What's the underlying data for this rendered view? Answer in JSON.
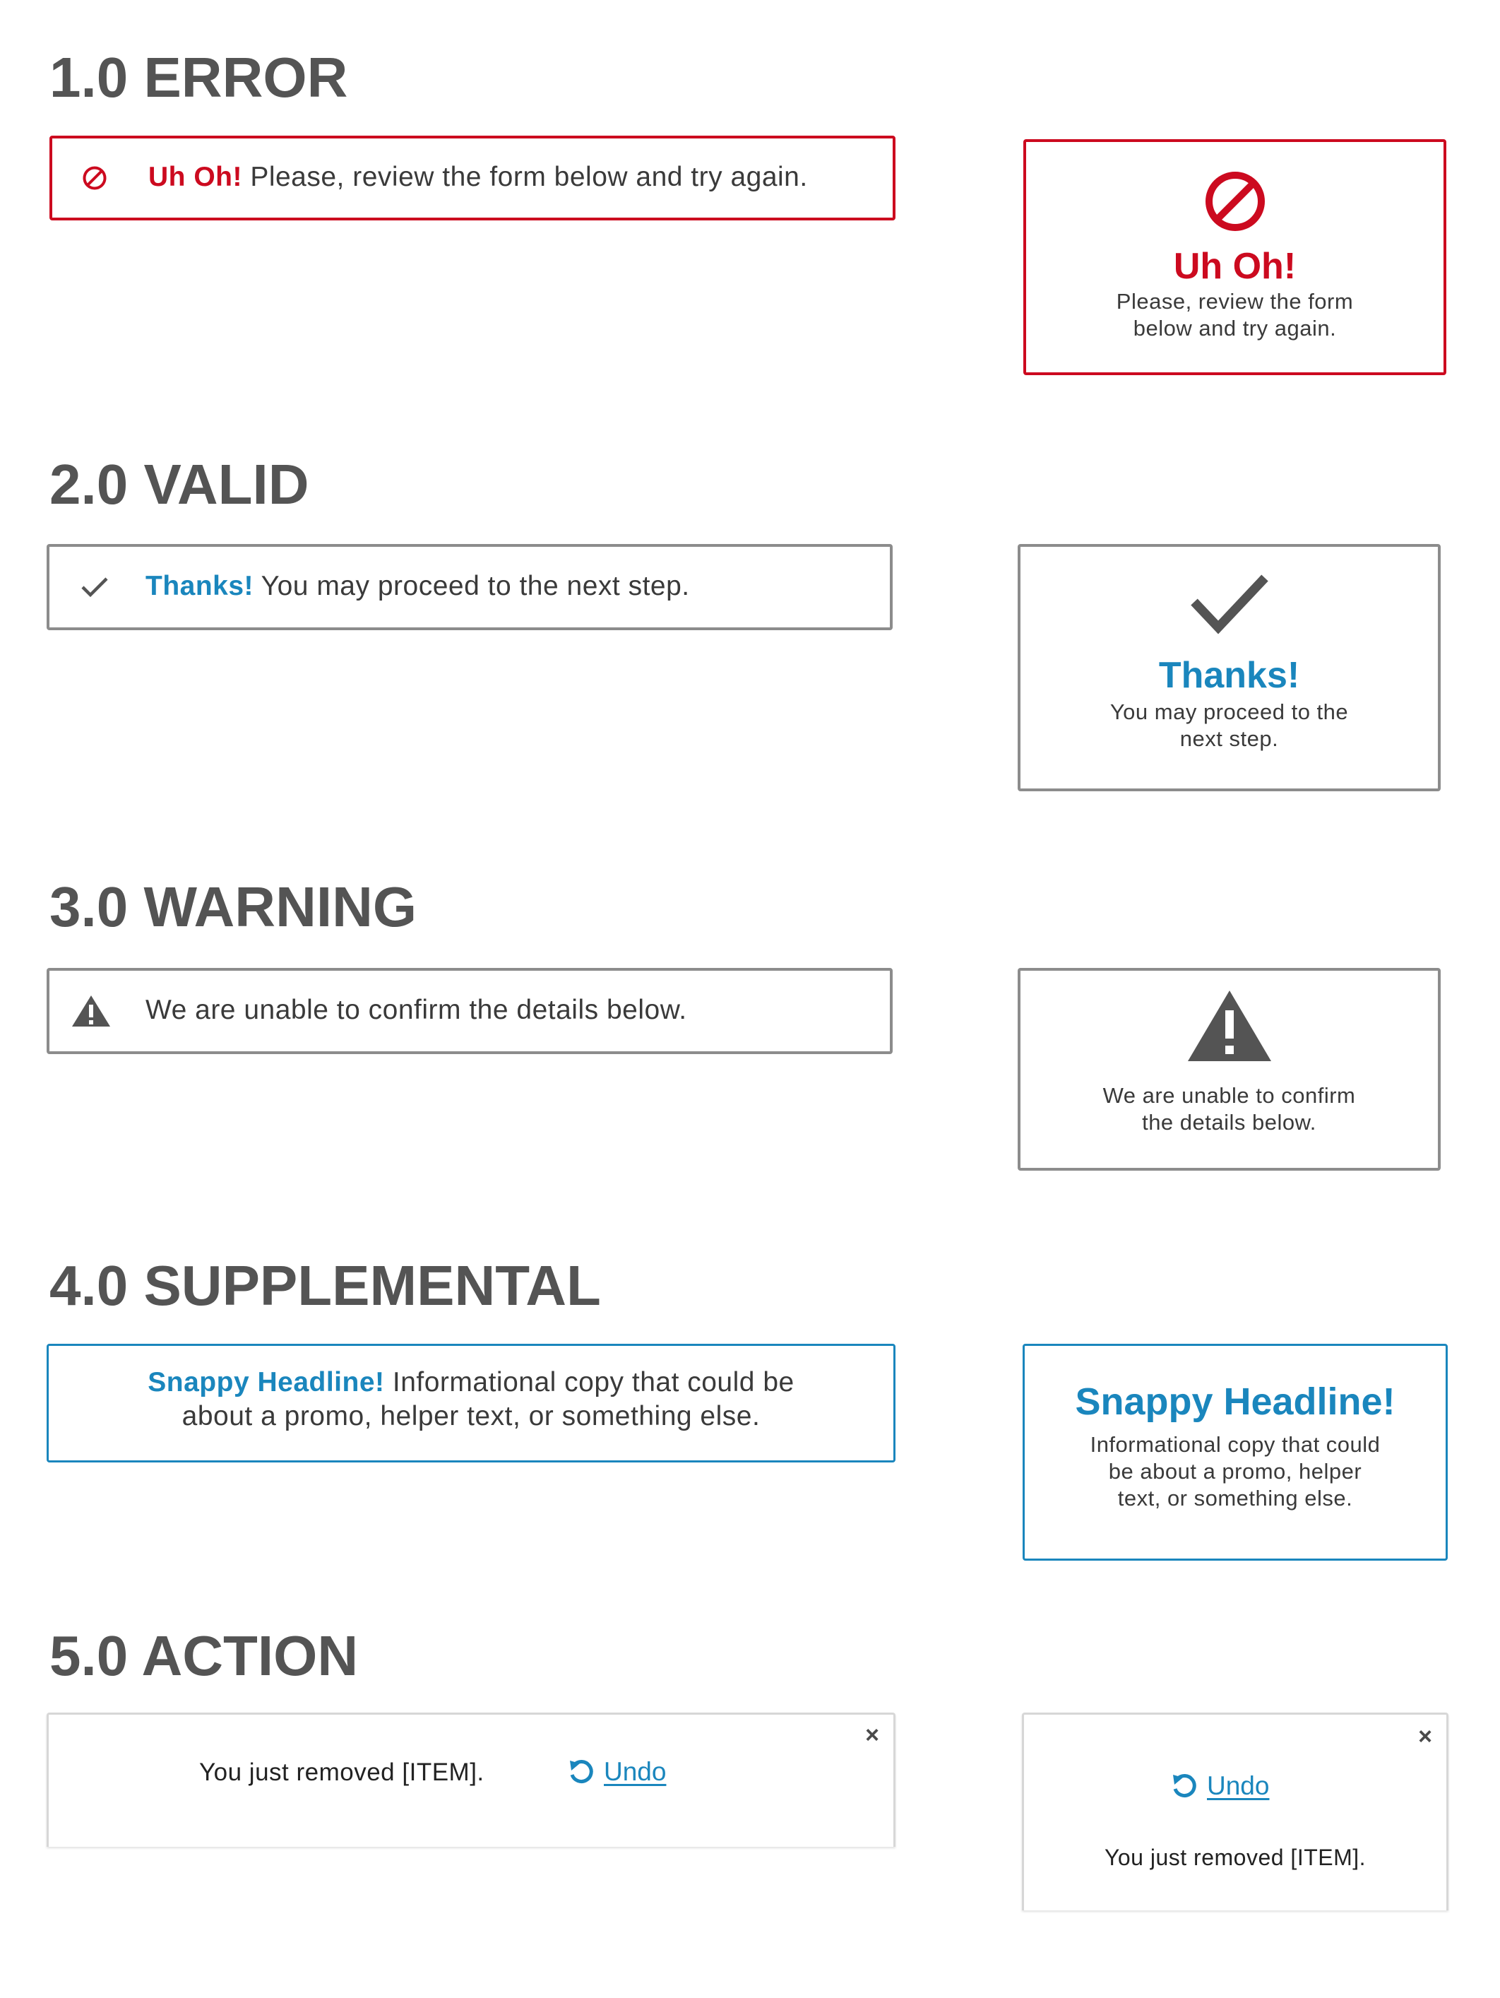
{
  "sections": {
    "error": {
      "heading": "1.0 ERROR",
      "lead": "Uh Oh!",
      "message": "Please, review the form below and try again.",
      "card_title": "Uh Oh!",
      "card_line1": "Please, review the form",
      "card_line2": "below and try again.",
      "icon": "prohibited-icon"
    },
    "valid": {
      "heading": "2.0 VALID",
      "lead": "Thanks!",
      "message": "You may proceed to the next step.",
      "card_title": "Thanks!",
      "card_line1": "You may proceed to the",
      "card_line2": "next step.",
      "icon": "checkmark-icon"
    },
    "warning": {
      "heading": "3.0 WARNING",
      "message": "We are unable to confirm the details below.",
      "card_line1": "We are unable to confirm",
      "card_line2": "the details below.",
      "icon": "warning-triangle-icon"
    },
    "supplemental": {
      "heading": "4.0 SUPPLEMENTAL",
      "lead": "Snappy Headline!",
      "message_line1": "Informational copy that could be",
      "message_line2": "about a promo, helper text, or something else.",
      "card_title": "Snappy Headline!",
      "card_line1": "Informational copy that could",
      "card_line2": "be about a promo, helper",
      "card_line3": "text, or something else."
    },
    "action": {
      "heading": "5.0 ACTION",
      "message": "You just removed [ITEM].",
      "undo_label": "Undo",
      "close_glyph": "×",
      "icons": [
        "undo-icon",
        "close-icon"
      ]
    }
  },
  "colors": {
    "error": "#cc0a1f",
    "info": "#1a86bd",
    "neutral_border": "#8c8c8c",
    "heading": "#545454"
  }
}
